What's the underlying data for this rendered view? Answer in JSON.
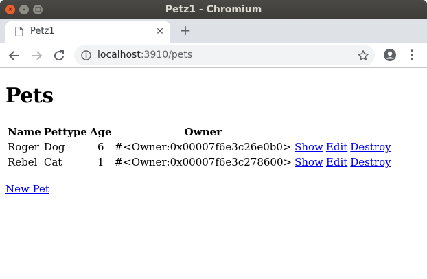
{
  "window": {
    "title": "Petz1 - Chromium",
    "close": "×",
    "minimize": "–",
    "maximize": "□"
  },
  "tab": {
    "title": "Petz1",
    "close": "✕"
  },
  "newtab": "+",
  "address": {
    "host": "localhost",
    "rest": ":3910/pets"
  },
  "page": {
    "heading": "Pets",
    "columns": [
      "Name",
      "Pettype",
      "Age",
      "Owner"
    ],
    "rows": [
      {
        "name": "Roger",
        "pettype": "Dog",
        "age": "6",
        "owner": "#<Owner:0x00007f6e3c26e0b0>",
        "show": "Show",
        "edit": "Edit",
        "destroy": "Destroy"
      },
      {
        "name": "Rebel",
        "pettype": "Cat",
        "age": "1",
        "owner": "#<Owner:0x00007f6e3c278600>",
        "show": "Show",
        "edit": "Edit",
        "destroy": "Destroy"
      }
    ],
    "new_link": "New Pet"
  }
}
